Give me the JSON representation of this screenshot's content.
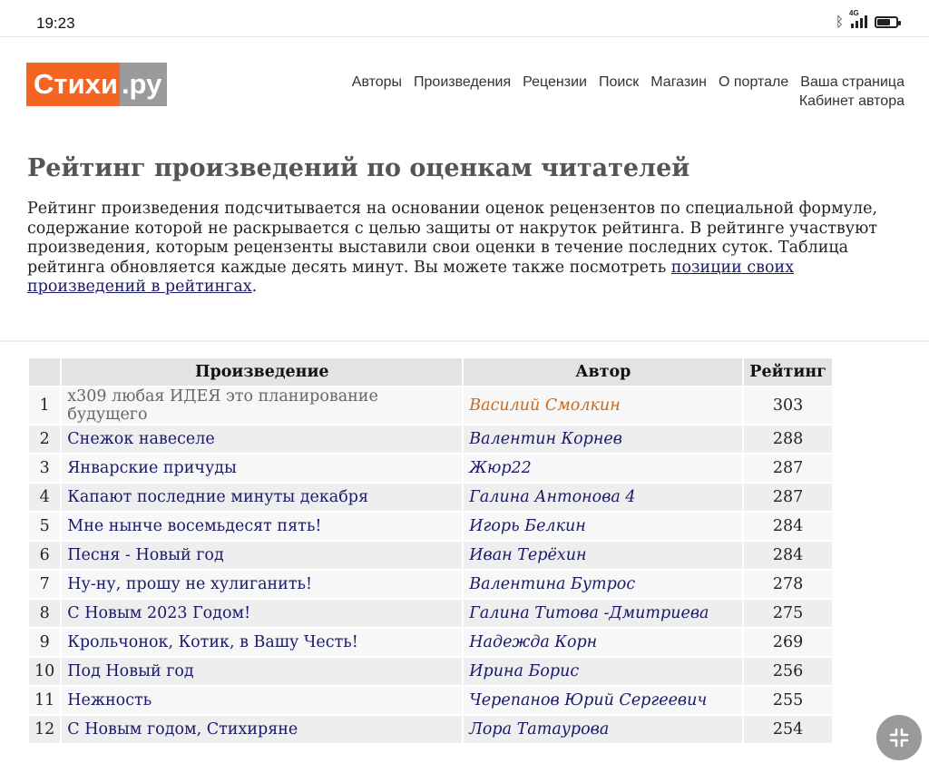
{
  "status_bar": {
    "time": "19:23",
    "network_label": "4G",
    "battery_level": 0.7
  },
  "logo": {
    "part1": "Стихи",
    "part2": ".ру"
  },
  "nav": {
    "items": [
      "Авторы",
      "Произведения",
      "Рецензии",
      "Поиск",
      "Магазин",
      "О портале",
      "Ваша страница"
    ],
    "second_row": "Кабинет автора"
  },
  "page_title": "Рейтинг произведений по оценкам читателей",
  "intro": {
    "text": "Рейтинг произведения подсчитывается на основании оценок рецензентов по специальной формуле, содержание которой не раскрывается с целью защиты от накруток рейтинга. В рейтинге участвуют произведения, которым рецензенты выставили свои оценки в течение последних суток. Таблица рейтинга обновляется каждые десять минут. Вы можете также посмотреть ",
    "link": "позиции своих произведений в рейтингах",
    "end": "."
  },
  "table": {
    "headers": [
      "",
      "Произведение",
      "Автор",
      "Рейтинг"
    ],
    "rows": [
      {
        "n": "1",
        "work": "х309 любая ИДЕЯ это планирование будущего",
        "author": "Василий Смолкин",
        "rating": "303",
        "visited": true
      },
      {
        "n": "2",
        "work": "Снежок навеселе",
        "author": "Валентин Корнев",
        "rating": "288"
      },
      {
        "n": "3",
        "work": "Январские причуды",
        "author": "Жюр22",
        "rating": "287"
      },
      {
        "n": "4",
        "work": "Капают последние минуты декабря",
        "author": "Галина Антонова 4",
        "rating": "287"
      },
      {
        "n": "5",
        "work": "Мне нынче восемьдесят пять!",
        "author": "Игорь Белкин",
        "rating": "284"
      },
      {
        "n": "6",
        "work": "Песня - Новый год",
        "author": "Иван Терёхин",
        "rating": "284"
      },
      {
        "n": "7",
        "work": "Ну-ну, прошу не хулиганить!",
        "author": "Валентина Бутрос",
        "rating": "278"
      },
      {
        "n": "8",
        "work": "С Новым 2023 Годом!",
        "author": "Галина Титова -Дмитриева",
        "rating": "275"
      },
      {
        "n": "9",
        "work": "Крольчонок, Котик, в Вашу Честь!",
        "author": "Надежда Корн",
        "rating": "269"
      },
      {
        "n": "10",
        "work": "Под Новый год",
        "author": "Ирина Борис",
        "rating": "256"
      },
      {
        "n": "11",
        "work": "Нежность",
        "author": "Черепанов Юрий Сергеевич",
        "rating": "255"
      },
      {
        "n": "12",
        "work": "С Новым годом, Стихиряне",
        "author": "Лора Татаурова",
        "rating": "254"
      }
    ]
  },
  "colors": {
    "logo_orange": "#f26522",
    "logo_gray": "#9b9b9b",
    "link": "#1a1a66",
    "visited_author": "#c86b1f"
  }
}
